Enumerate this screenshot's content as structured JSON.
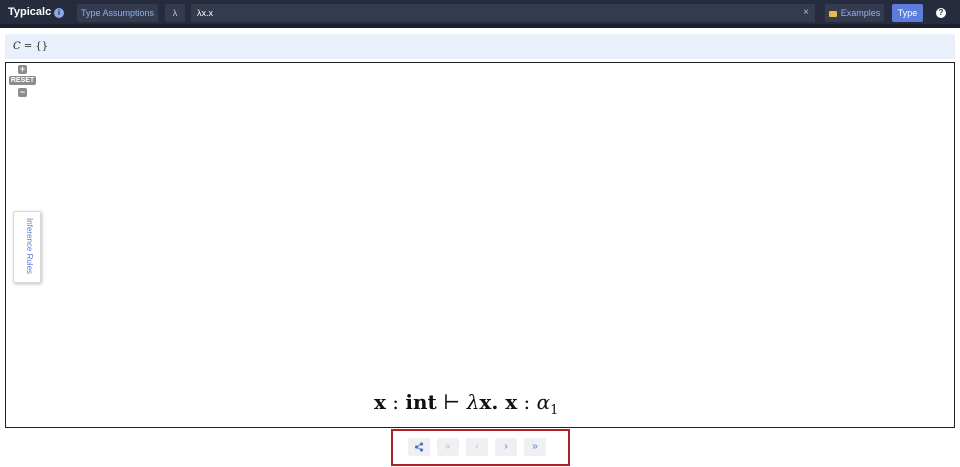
{
  "header": {
    "brand": "Typicalc",
    "info_icon": "info-icon",
    "type_assumptions_label": "Type Assumptions",
    "lambda_label": "λ",
    "expression_value": "λx.x",
    "clear_label": "×",
    "examples_label": "Examples",
    "type_label": "Type",
    "help_label": "?"
  },
  "constraints": {
    "symbol": "C",
    "equals": " = ",
    "set": "{}"
  },
  "canvas": {
    "zoom_in_label": "+",
    "reset_label": "RESET",
    "zoom_out_label": "−",
    "inference_rules_label": "Inference Rules",
    "judgment": {
      "var": "x",
      "colon1": " : ",
      "type": "int",
      "turnstile": " ⊢ ",
      "lambda": "λ",
      "body": "x. x",
      "colon2": " : ",
      "alpha": "α",
      "subscript": "1"
    }
  },
  "nav": {
    "share_icon": "share-icon",
    "first_label": "«",
    "prev_label": "‹",
    "next_label": "›",
    "last_label": "»"
  },
  "colors": {
    "topbar": "#262c3d",
    "accent": "#5d7ddd",
    "highlight_border": "#b02020"
  }
}
